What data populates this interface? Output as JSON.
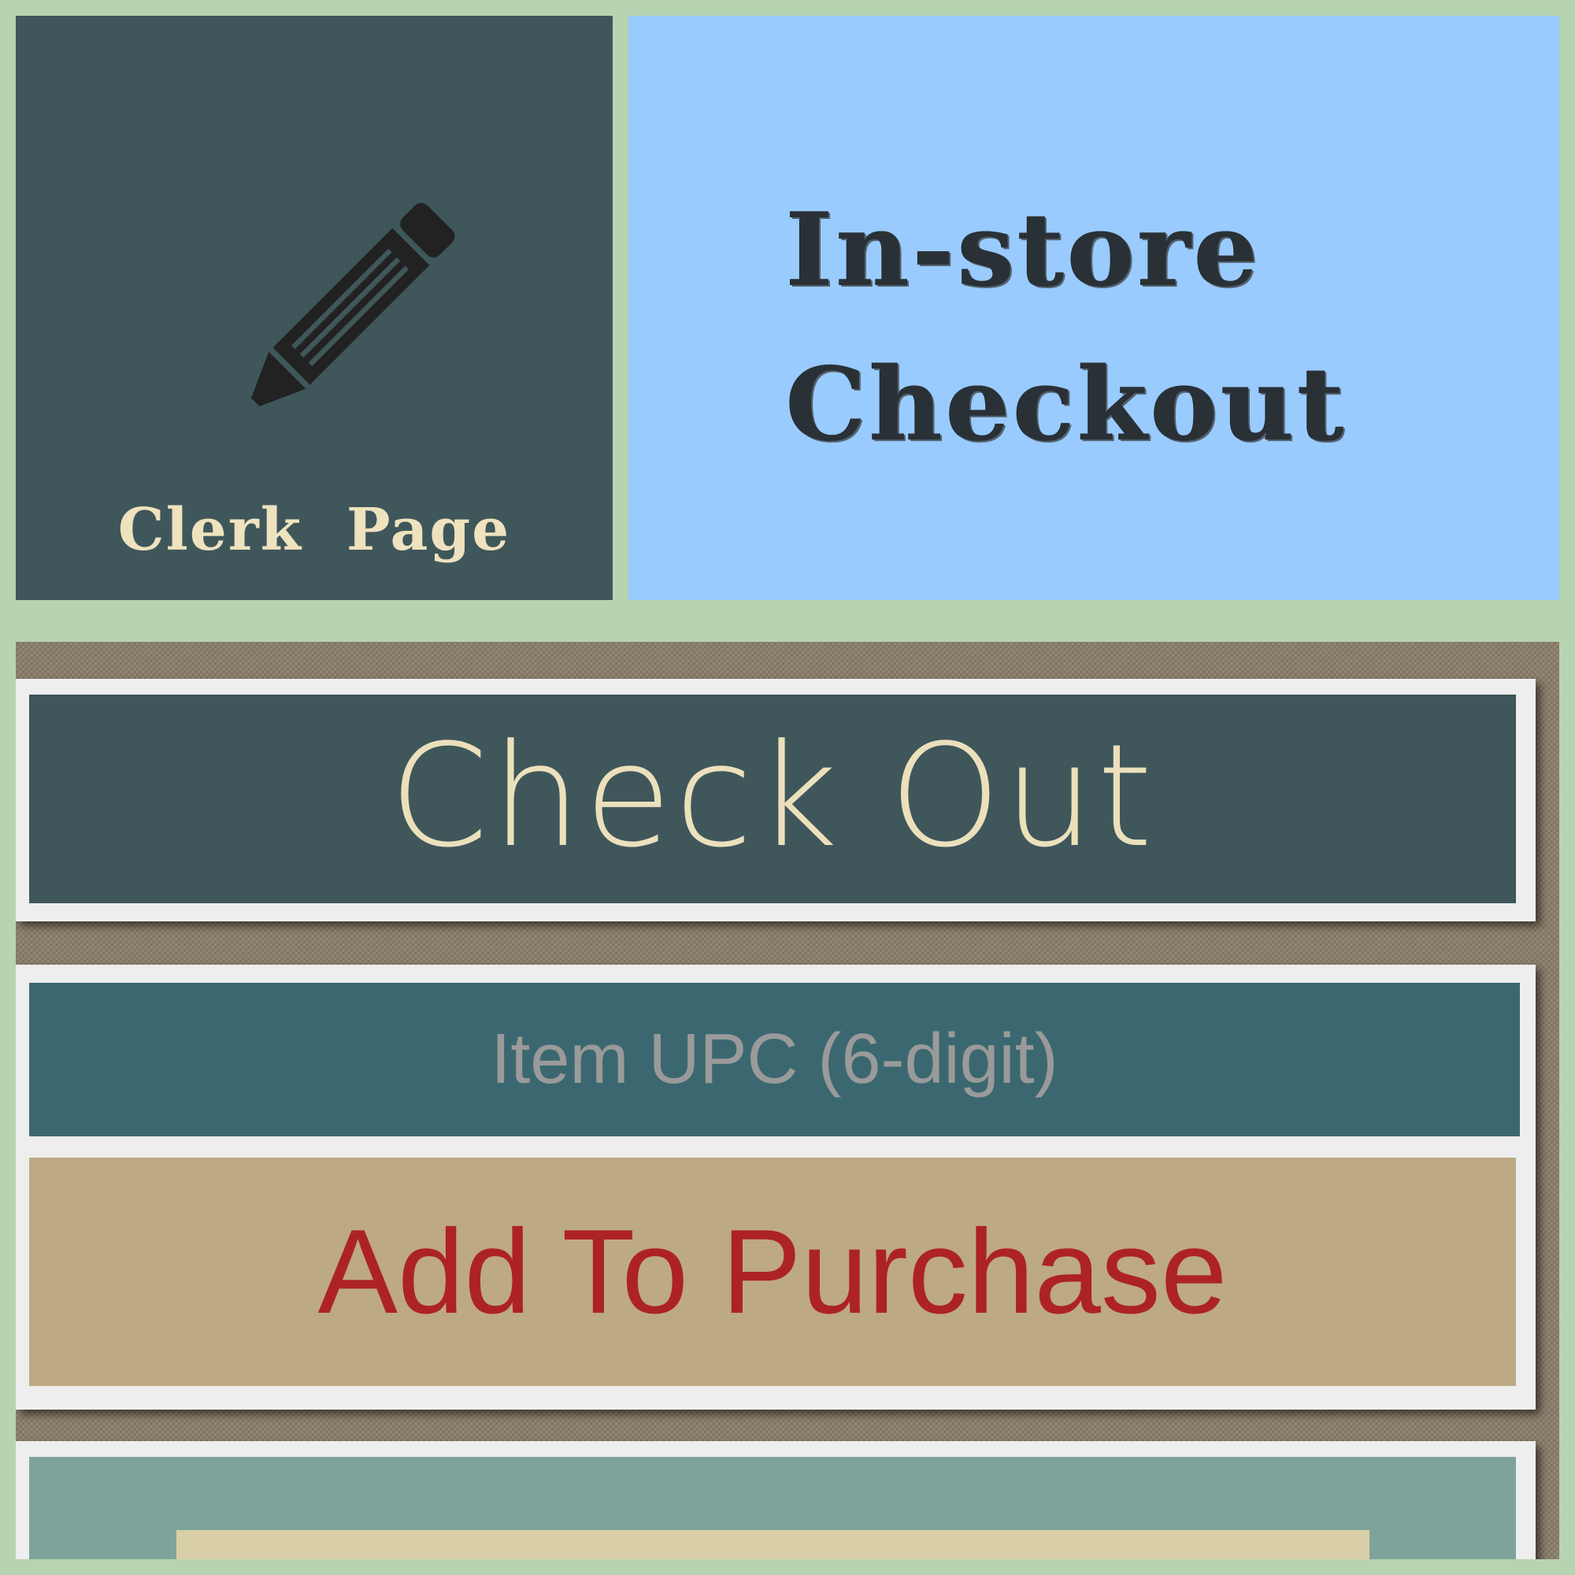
{
  "clerk_tile": {
    "label": "Clerk Page",
    "icon": "pencil-icon",
    "background": "#3f575b",
    "label_color": "#efe2be"
  },
  "title_tile": {
    "line1": "In-store",
    "line2": "Checkout",
    "background": "#99cbfe"
  },
  "checkout": {
    "header": "Check Out",
    "upc_input": {
      "placeholder": "Item UPC (6-digit)",
      "value": ""
    },
    "add_button_label": "Add To Purchase",
    "colors": {
      "header_bg": "#3f575b",
      "input_bg": "#3b6870",
      "button_bg": "#bda983",
      "button_text": "#ad2323"
    }
  }
}
